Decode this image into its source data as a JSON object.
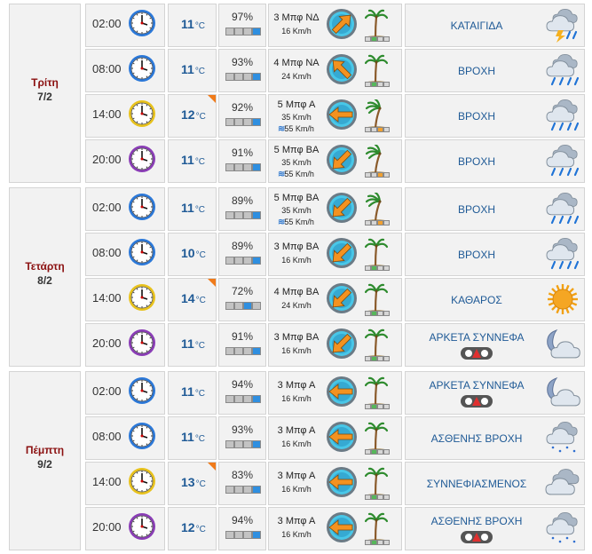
{
  "units": {
    "temp": "°C"
  },
  "days": [
    {
      "name": "Τρίτη",
      "date": "7/2",
      "rows": [
        {
          "time": "02:00",
          "clock": "blue-clock-icon",
          "temp": "11",
          "hot": false,
          "hum": "97%",
          "hbars": 3,
          "wind": "3 Μπφ ΝΔ",
          "speed": "16 Km/h",
          "gust": "",
          "dir": 45,
          "tree": "tree-calm",
          "wsc": "#56b75a",
          "cond": "ΚΑΤΑΙΓΙΔΑ",
          "icon": "thunderstorm-icon",
          "badge": false
        },
        {
          "time": "08:00",
          "clock": "blue-clock-icon",
          "temp": "11",
          "hot": false,
          "hum": "93%",
          "hbars": 3,
          "wind": "4 Μπφ ΝΑ",
          "speed": "24 Km/h",
          "gust": "",
          "dir": 315,
          "tree": "tree-calm",
          "wsc": "#56b75a",
          "cond": "ΒΡΟΧΗ",
          "icon": "rain-icon",
          "badge": false
        },
        {
          "time": "14:00",
          "clock": "yellow-clock-icon",
          "temp": "12",
          "hot": true,
          "hum": "92%",
          "hbars": 3,
          "wind": "5 Μπφ Α",
          "speed": "35 Km/h",
          "gust": "55 Km/h",
          "dir": 270,
          "tree": "tree-windy",
          "wsc": "#f0a030",
          "cond": "ΒΡΟΧΗ",
          "icon": "rain-icon",
          "badge": false
        },
        {
          "time": "20:00",
          "clock": "purple-clock-icon",
          "temp": "11",
          "hot": false,
          "hum": "91%",
          "hbars": 3,
          "wind": "5 Μπφ ΒΑ",
          "speed": "35 Km/h",
          "gust": "55 Km/h",
          "dir": 225,
          "tree": "tree-windy",
          "wsc": "#f0a030",
          "cond": "ΒΡΟΧΗ",
          "icon": "rain-icon",
          "badge": false
        }
      ]
    },
    {
      "name": "Τετάρτη",
      "date": "8/2",
      "rows": [
        {
          "time": "02:00",
          "clock": "blue-clock-icon",
          "temp": "11",
          "hot": false,
          "hum": "89%",
          "hbars": 3,
          "wind": "5 Μπφ ΒΑ",
          "speed": "35 Km/h",
          "gust": "55 Km/h",
          "dir": 225,
          "tree": "tree-windy",
          "wsc": "#f0a030",
          "cond": "ΒΡΟΧΗ",
          "icon": "rain-icon",
          "badge": false
        },
        {
          "time": "08:00",
          "clock": "blue-clock-icon",
          "temp": "10",
          "hot": false,
          "hum": "89%",
          "hbars": 3,
          "wind": "3 Μπφ ΒΑ",
          "speed": "16 Km/h",
          "gust": "",
          "dir": 225,
          "tree": "tree-calm",
          "wsc": "#56b75a",
          "cond": "ΒΡΟΧΗ",
          "icon": "rain-icon",
          "badge": false
        },
        {
          "time": "14:00",
          "clock": "yellow-clock-icon",
          "temp": "14",
          "hot": true,
          "hum": "72%",
          "hbars": 2,
          "wind": "4 Μπφ ΒΑ",
          "speed": "24 Km/h",
          "gust": "",
          "dir": 225,
          "tree": "tree-calm",
          "wsc": "#56b75a",
          "cond": "ΚΑΘΑΡΟΣ",
          "icon": "sun-icon",
          "badge": false
        },
        {
          "time": "20:00",
          "clock": "purple-clock-icon",
          "temp": "11",
          "hot": false,
          "hum": "91%",
          "hbars": 3,
          "wind": "3 Μπφ ΒΑ",
          "speed": "16 Km/h",
          "gust": "",
          "dir": 225,
          "tree": "tree-calm",
          "wsc": "#56b75a",
          "cond": "ΑΡΚΕΤΑ ΣΥΝΝΕΦΑ",
          "icon": "moon-cloud-icon",
          "badge": true
        }
      ]
    },
    {
      "name": "Πέμπτη",
      "date": "9/2",
      "rows": [
        {
          "time": "02:00",
          "clock": "blue-clock-icon",
          "temp": "11",
          "hot": false,
          "hum": "94%",
          "hbars": 3,
          "wind": "3 Μπφ Α",
          "speed": "16 Km/h",
          "gust": "",
          "dir": 270,
          "tree": "tree-calm",
          "wsc": "#56b75a",
          "cond": "ΑΡΚΕΤΑ ΣΥΝΝΕΦΑ",
          "icon": "moon-cloud-icon",
          "badge": true
        },
        {
          "time": "08:00",
          "clock": "blue-clock-icon",
          "temp": "11",
          "hot": false,
          "hum": "93%",
          "hbars": 3,
          "wind": "3 Μπφ Α",
          "speed": "16 Km/h",
          "gust": "",
          "dir": 270,
          "tree": "tree-calm",
          "wsc": "#56b75a",
          "cond": "ΑΣΘΕΝΗΣ ΒΡΟΧΗ",
          "icon": "light-rain-icon",
          "badge": false
        },
        {
          "time": "14:00",
          "clock": "yellow-clock-icon",
          "temp": "13",
          "hot": true,
          "hum": "83%",
          "hbars": 3,
          "wind": "3 Μπφ Α",
          "speed": "16 Km/h",
          "gust": "",
          "dir": 270,
          "tree": "tree-calm",
          "wsc": "#56b75a",
          "cond": "ΣΥΝΝΕΦΙΑΣΜΕΝΟΣ",
          "icon": "cloudy-icon",
          "badge": false
        },
        {
          "time": "20:00",
          "clock": "purple-clock-icon",
          "temp": "12",
          "hot": false,
          "hum": "94%",
          "hbars": 3,
          "wind": "3 Μπφ Α",
          "speed": "16 Km/h",
          "gust": "",
          "dir": 270,
          "tree": "tree-calm",
          "wsc": "#56b75a",
          "cond": "ΑΣΘΕΝΗΣ ΒΡΟΧΗ",
          "icon": "light-rain-icon",
          "badge": true
        }
      ]
    }
  ],
  "colors": {
    "blue-clock-icon": "#2b78d8",
    "yellow-clock-icon": "#e8c21d",
    "purple-clock-icon": "#8a3db6",
    "humidity_fill": "#2f8fe0",
    "hot_marker": "#f07b1a",
    "condition_text": "#1f5a96",
    "temp_text": "#1f5a96",
    "day_name": "#8b1010"
  }
}
